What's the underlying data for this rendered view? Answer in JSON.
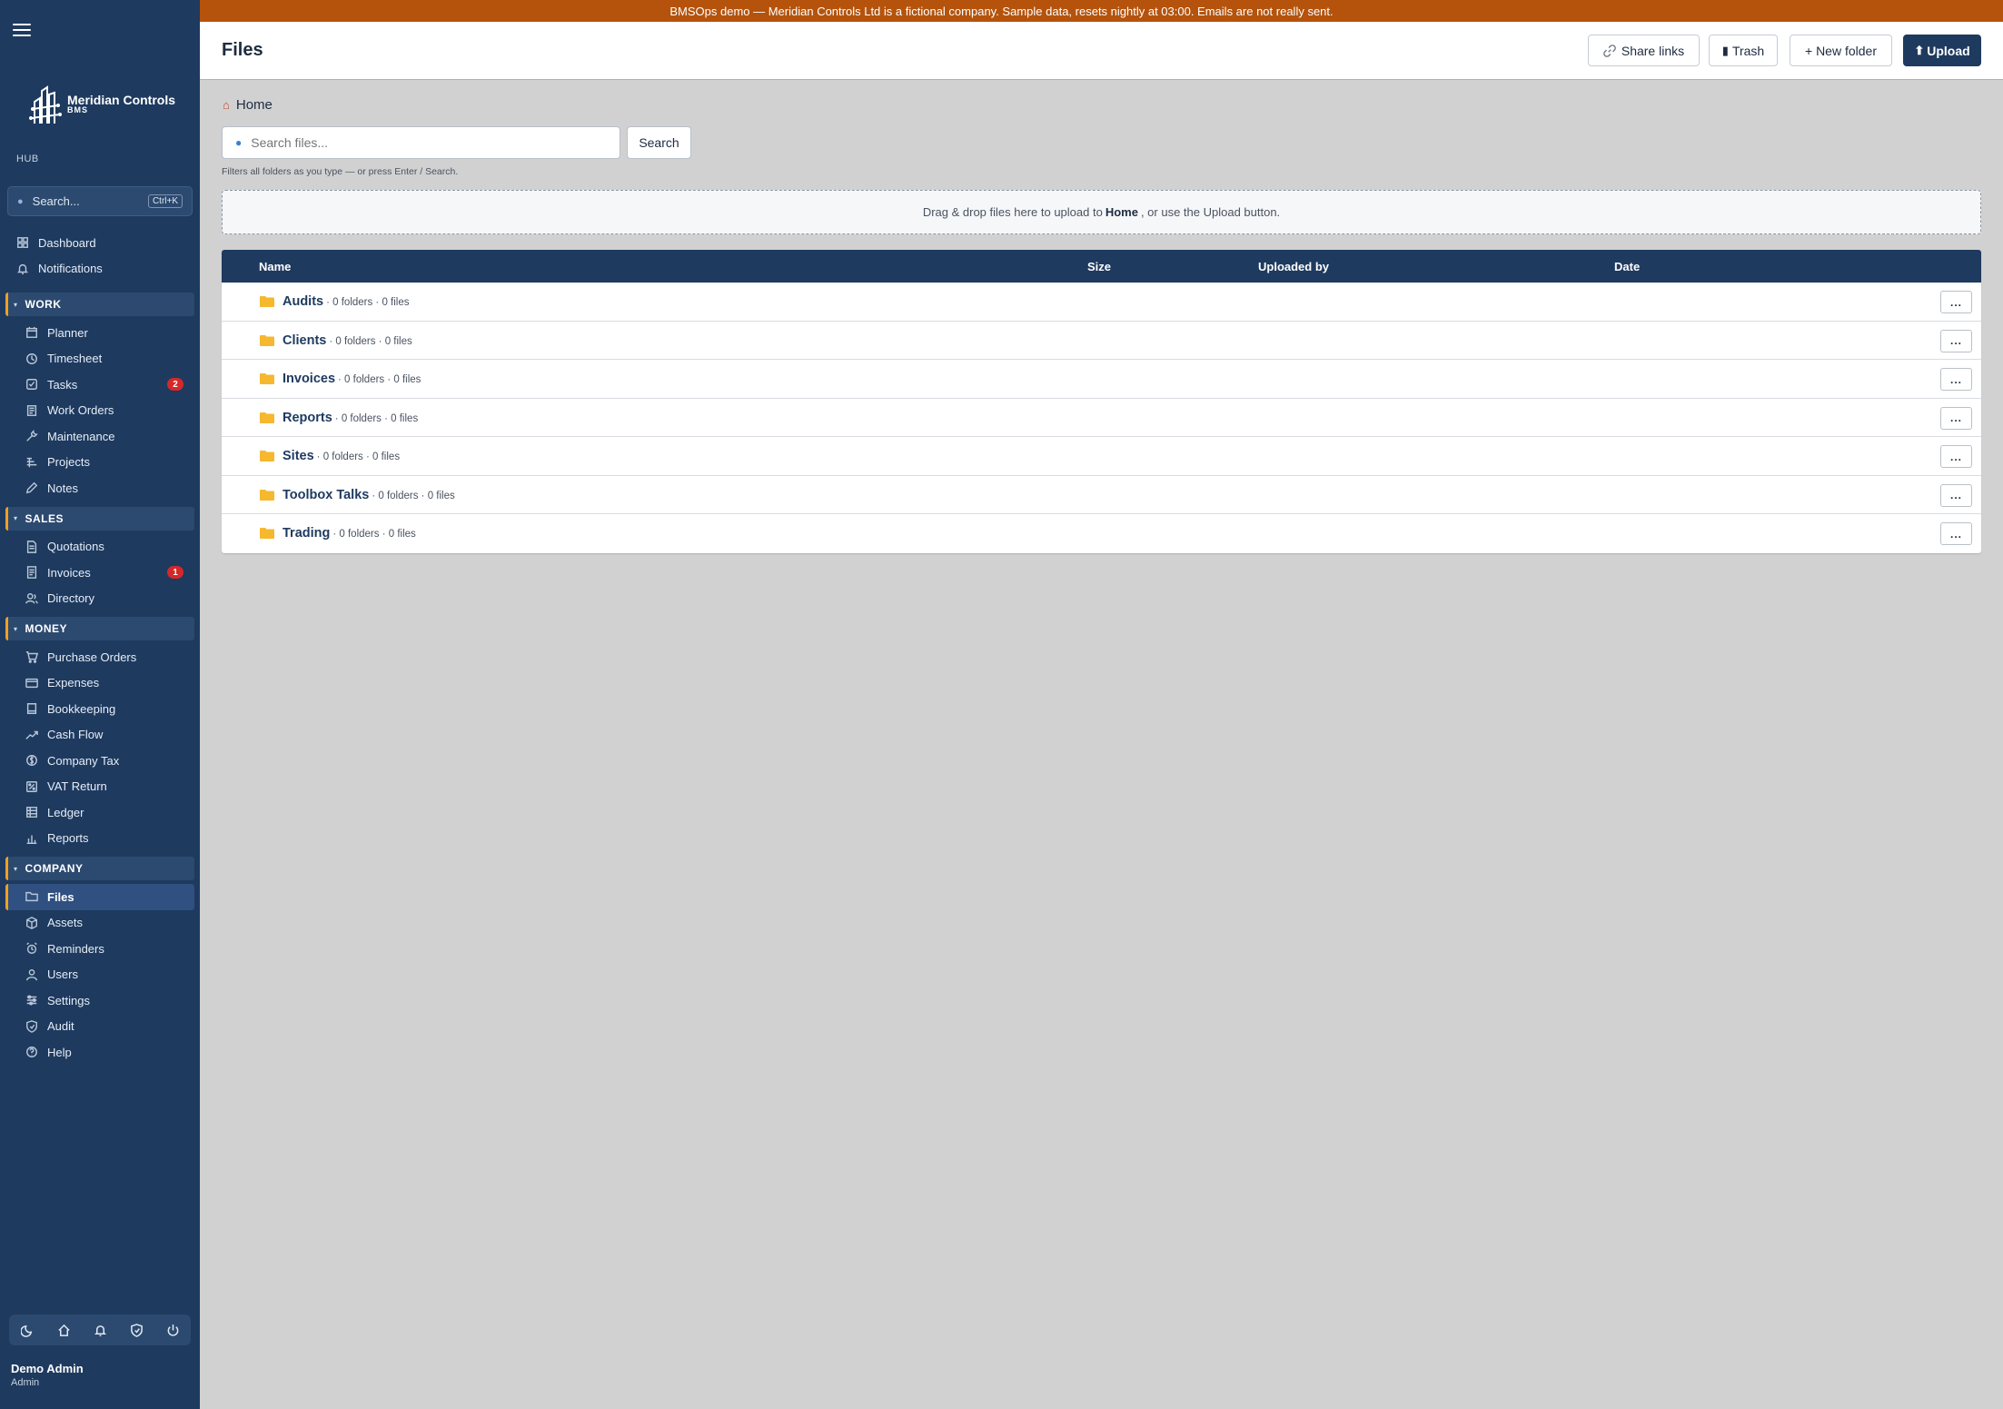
{
  "banner": "BMSOps demo — Meridian Controls Ltd is a fictional company. Sample data, resets nightly at 03:00. Emails are not really sent.",
  "brand": {
    "name": "Meridian Controls",
    "sub": "BMS"
  },
  "sidebar": {
    "hub_label": "HUB",
    "search_placeholder": "Search...",
    "search_shortcut": "Ctrl+K",
    "top_items": [
      {
        "label": "Dashboard",
        "icon": "grid-icon"
      },
      {
        "label": "Notifications",
        "icon": "bell-icon"
      }
    ],
    "sections": [
      {
        "title": "WORK",
        "items": [
          {
            "label": "Planner",
            "icon": "calendar-icon"
          },
          {
            "label": "Timesheet",
            "icon": "clock-icon"
          },
          {
            "label": "Tasks",
            "icon": "checkbox-icon",
            "badge": "2"
          },
          {
            "label": "Work Orders",
            "icon": "clipboard-icon"
          },
          {
            "label": "Maintenance",
            "icon": "wrench-icon"
          },
          {
            "label": "Projects",
            "icon": "projects-icon"
          },
          {
            "label": "Notes",
            "icon": "pencil-icon"
          }
        ]
      },
      {
        "title": "SALES",
        "items": [
          {
            "label": "Quotations",
            "icon": "document-icon"
          },
          {
            "label": "Invoices",
            "icon": "invoice-icon",
            "badge": "1"
          },
          {
            "label": "Directory",
            "icon": "people-icon"
          }
        ]
      },
      {
        "title": "MONEY",
        "items": [
          {
            "label": "Purchase Orders",
            "icon": "cart-icon"
          },
          {
            "label": "Expenses",
            "icon": "card-icon"
          },
          {
            "label": "Bookkeeping",
            "icon": "book-icon"
          },
          {
            "label": "Cash Flow",
            "icon": "trend-icon"
          },
          {
            "label": "Company Tax",
            "icon": "tax-icon"
          },
          {
            "label": "VAT Return",
            "icon": "percent-icon"
          },
          {
            "label": "Ledger",
            "icon": "table-icon"
          },
          {
            "label": "Reports",
            "icon": "bar-chart-icon"
          }
        ]
      },
      {
        "title": "COMPANY",
        "items": [
          {
            "label": "Files",
            "icon": "folder-icon",
            "active": true
          },
          {
            "label": "Assets",
            "icon": "box-icon"
          },
          {
            "label": "Reminders",
            "icon": "alarm-icon"
          },
          {
            "label": "Users",
            "icon": "user-icon"
          },
          {
            "label": "Settings",
            "icon": "sliders-icon"
          },
          {
            "label": "Audit",
            "icon": "shield-icon"
          },
          {
            "label": "Help",
            "icon": "help-icon"
          }
        ]
      }
    ],
    "user": {
      "name": "Demo Admin",
      "role": "Admin"
    }
  },
  "header": {
    "title": "Files",
    "share_links": "Share links",
    "trash": "Trash",
    "new_folder": "+ New folder",
    "upload": "Upload"
  },
  "breadcrumb": {
    "home": "Home"
  },
  "search": {
    "placeholder": "Search files...",
    "button": "Search",
    "hint": "Filters all folders as you type — or press Enter / Search."
  },
  "dropzone": {
    "before": "Drag & drop files here to upload to",
    "target": "Home",
    "after": ", or use the Upload button."
  },
  "table": {
    "columns": {
      "name": "Name",
      "size": "Size",
      "uploaded_by": "Uploaded by",
      "date": "Date"
    },
    "rows": [
      {
        "name": "Audits",
        "meta": "· 0 folders · 0 files"
      },
      {
        "name": "Clients",
        "meta": "· 0 folders · 0 files"
      },
      {
        "name": "Invoices",
        "meta": "· 0 folders · 0 files"
      },
      {
        "name": "Reports",
        "meta": "· 0 folders · 0 files"
      },
      {
        "name": "Sites",
        "meta": "· 0 folders · 0 files"
      },
      {
        "name": "Toolbox Talks",
        "meta": "· 0 folders · 0 files"
      },
      {
        "name": "Trading",
        "meta": "· 0 folders · 0 files"
      }
    ],
    "row_action": "..."
  },
  "colors": {
    "sidebar": "#1e3a5f",
    "banner": "#b5530c",
    "accent": "#f0a020",
    "badge": "#d62828",
    "folder": "#f5b82e"
  }
}
